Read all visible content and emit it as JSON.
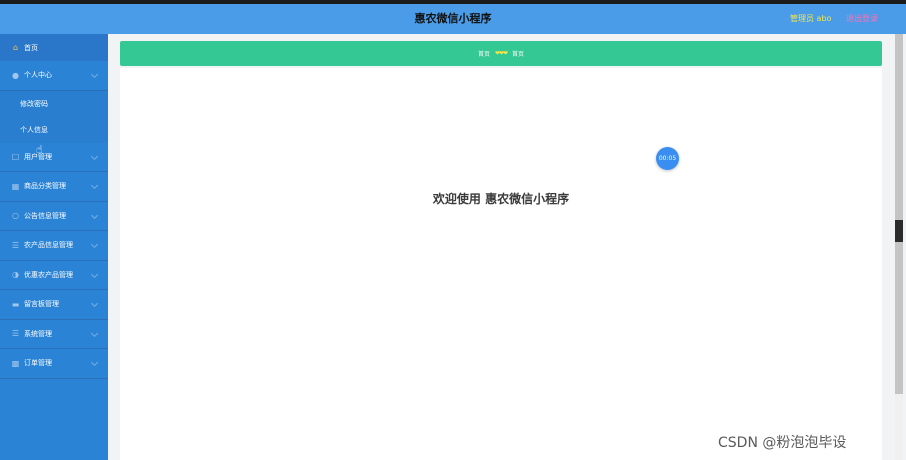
{
  "header": {
    "title": "惠农微信小程序",
    "admin_label": "管理员 abo",
    "logout_label": "退出登录"
  },
  "sidebar": {
    "items": [
      {
        "label": "首页",
        "icon": "home-icon"
      },
      {
        "label": "个人中心",
        "icon": "user-icon",
        "expanded": true,
        "children": [
          {
            "label": "修改密码"
          },
          {
            "label": "个人信息"
          }
        ]
      },
      {
        "label": "用户管理",
        "icon": "users-icon"
      },
      {
        "label": "商品分类管理",
        "icon": "category-icon"
      },
      {
        "label": "公告信息管理",
        "icon": "notice-icon"
      },
      {
        "label": "农产品信息管理",
        "icon": "list-icon"
      },
      {
        "label": "优惠农产品管理",
        "icon": "discount-icon"
      },
      {
        "label": "留言板管理",
        "icon": "message-icon"
      },
      {
        "label": "系统管理",
        "icon": "system-icon"
      },
      {
        "label": "订单管理",
        "icon": "order-icon"
      }
    ]
  },
  "breadcrumb": {
    "home": "首页",
    "separator": "❤❤❤",
    "current": "首页"
  },
  "main": {
    "welcome": "欢迎使用 惠农微信小程序",
    "timer": "00:05"
  },
  "watermark": "CSDN @粉泡泡毕设",
  "colors": {
    "topbar": "#4a9ce8",
    "sidebar": "#2b83d6",
    "breadcrumb": "#34c894",
    "admin_text": "#f1e64a",
    "logout_text": "#ff6fb4"
  }
}
